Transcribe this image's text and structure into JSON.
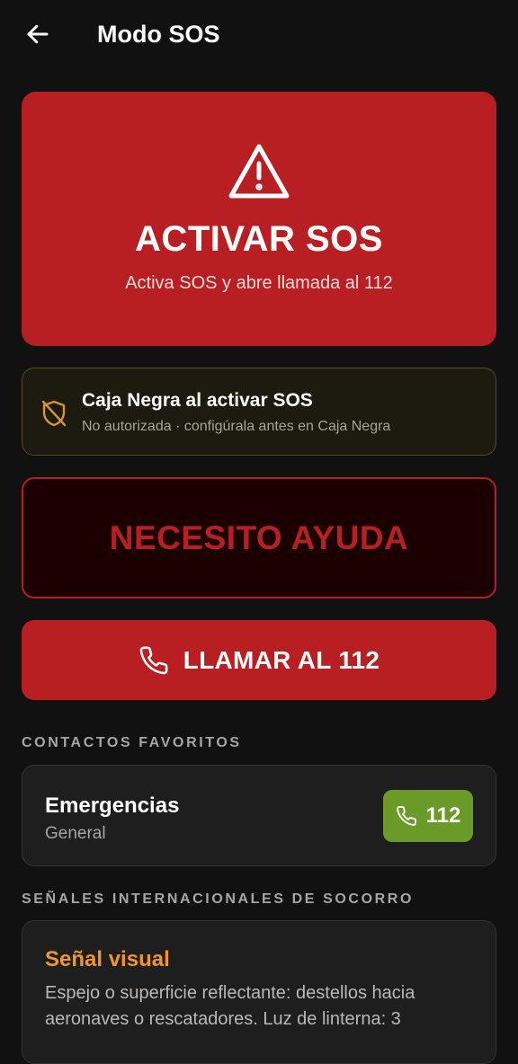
{
  "header": {
    "title": "Modo SOS",
    "back_icon": "arrow-left-icon"
  },
  "sos": {
    "icon": "warning-triangle-icon",
    "title": "ACTIVAR SOS",
    "subtitle": "Activa SOS y abre llamada al 112"
  },
  "black_box": {
    "icon": "shield-off-icon",
    "title": "Caja Negra al activar SOS",
    "status": "No autorizada · configúrala antes en Caja Negra"
  },
  "help_button": {
    "label": "NECESITO AYUDA"
  },
  "call_button": {
    "icon": "phone-icon",
    "label": "LLAMAR AL 112"
  },
  "favorites": {
    "section_label": "CONTACTOS FAVORITOS",
    "contacts": [
      {
        "name": "Emergencias",
        "group": "General",
        "call_label": "112",
        "icon": "phone-icon"
      }
    ]
  },
  "signals": {
    "section_label": "SEÑALES INTERNACIONALES DE SOCORRO",
    "items": [
      {
        "title": "Señal visual",
        "body": "Espejo o superficie reflectante: destellos hacia aeronaves o rescatadores. Luz de linterna: 3"
      }
    ]
  },
  "colors": {
    "background": "#111111",
    "sos_red": "#b71f22",
    "help_background": "#1a0000",
    "warning_amber": "#d4982c",
    "call_green": "#6a9a27",
    "signal_orange": "#f0962a",
    "card_background": "#1e1e1e"
  }
}
